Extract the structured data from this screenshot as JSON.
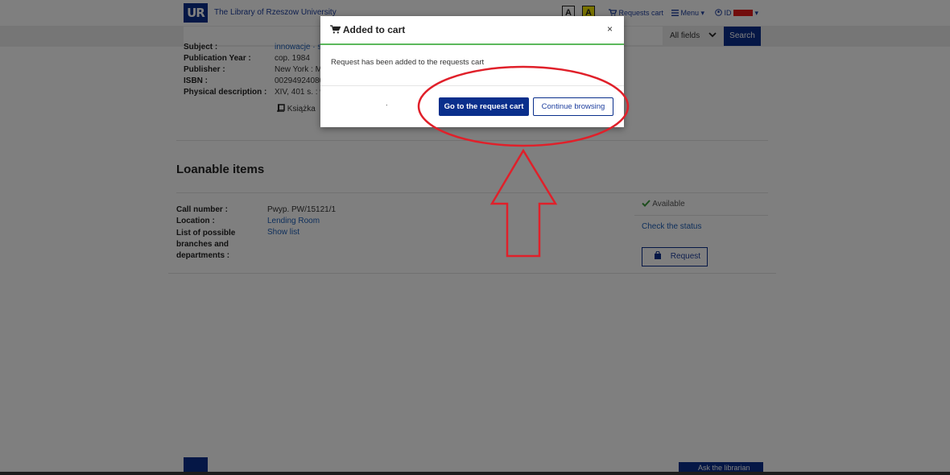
{
  "header": {
    "library_name": "The Library of Rzeszow University",
    "logo_text": "UR",
    "contrast_normal": "A",
    "contrast_high": "A",
    "requests_cart": "Requests cart",
    "menu": "Menu",
    "user_id": "ID"
  },
  "search": {
    "field_selector": "All fields",
    "button": "Search"
  },
  "details": [
    {
      "label": "Subject :",
      "value": "innowacje · s"
    },
    {
      "label": "Publication Year :",
      "value": "cop. 1984"
    },
    {
      "label": "Publisher :",
      "value": "New York : M"
    },
    {
      "label": "ISBN :",
      "value": "00294924080"
    },
    {
      "label": "Physical description :",
      "value": "XIV, 401 s. : w"
    }
  ],
  "format_label": "Książka",
  "loanable": {
    "title": "Loanable items",
    "rows": [
      {
        "label": "Call number :",
        "value": "Pwyp. PW/15121/1",
        "is_link": false
      },
      {
        "label": "Location :",
        "value": "Lending Room",
        "is_link": true
      },
      {
        "label": "List of possible branches and departments :",
        "value": "Show list",
        "is_link": true
      }
    ],
    "status": "Available",
    "check_status": "Check the status",
    "request_button": "Request"
  },
  "footer": {
    "ask_librarian": "Ask the librarian"
  },
  "modal": {
    "title": "Added to cart",
    "close": "×",
    "message": "Request has been added to the requests cart",
    "dot": ".",
    "go_to_cart": "Go to the request cart",
    "continue_browsing": "Continue browsing"
  },
  "colors": {
    "brand": "#0a2f8c",
    "annotation": "#e0202a",
    "success": "#5cb85c"
  },
  "icons": [
    "cart-icon",
    "menu-icon",
    "user-icon",
    "chevron-down-icon",
    "book-icon",
    "check-icon",
    "bag-icon",
    "close-icon"
  ]
}
